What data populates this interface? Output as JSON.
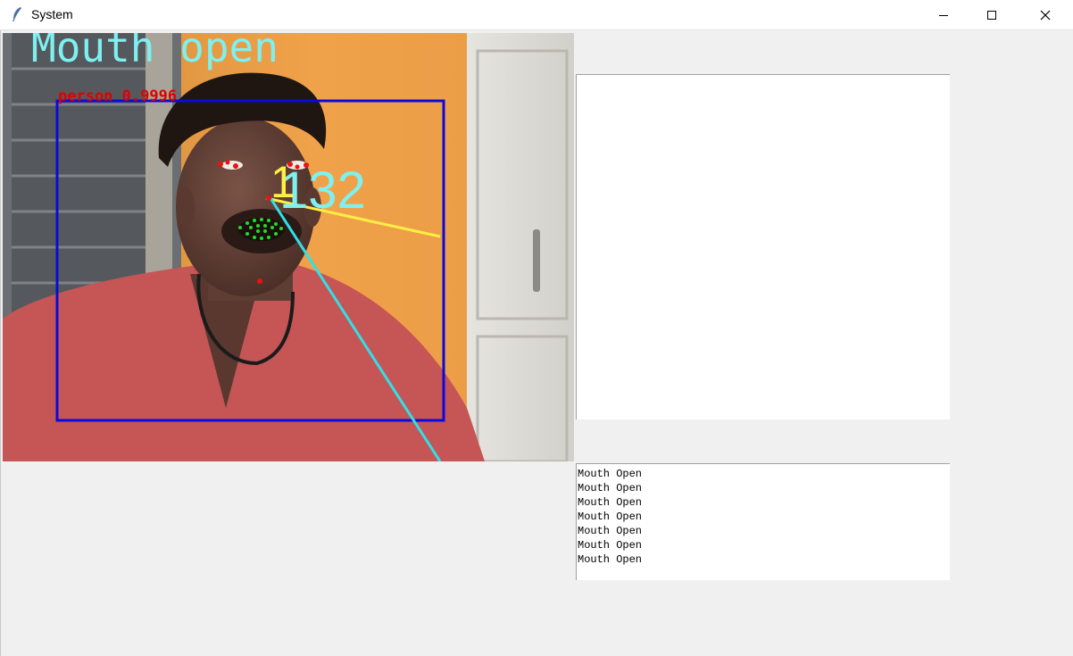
{
  "window": {
    "title": "System",
    "controls": [
      "minimize",
      "maximize",
      "close"
    ]
  },
  "video": {
    "status_text": "Mouth open",
    "detection_label": "person 0.9996",
    "counter_value": "132",
    "counter_value_overlay": "1"
  },
  "log": {
    "lines": [
      "Mouth Open",
      "Mouth Open",
      "Mouth Open",
      "Mouth Open",
      "Mouth Open",
      "Mouth Open",
      "Mouth Open"
    ]
  },
  "colors": {
    "box": "#0a0adc",
    "status_text": "#7ef0f0",
    "label": "#e00000",
    "yellow_line": "#ffee44",
    "cyan_line": "#30e0e8",
    "landmarks": "#22dd22"
  }
}
